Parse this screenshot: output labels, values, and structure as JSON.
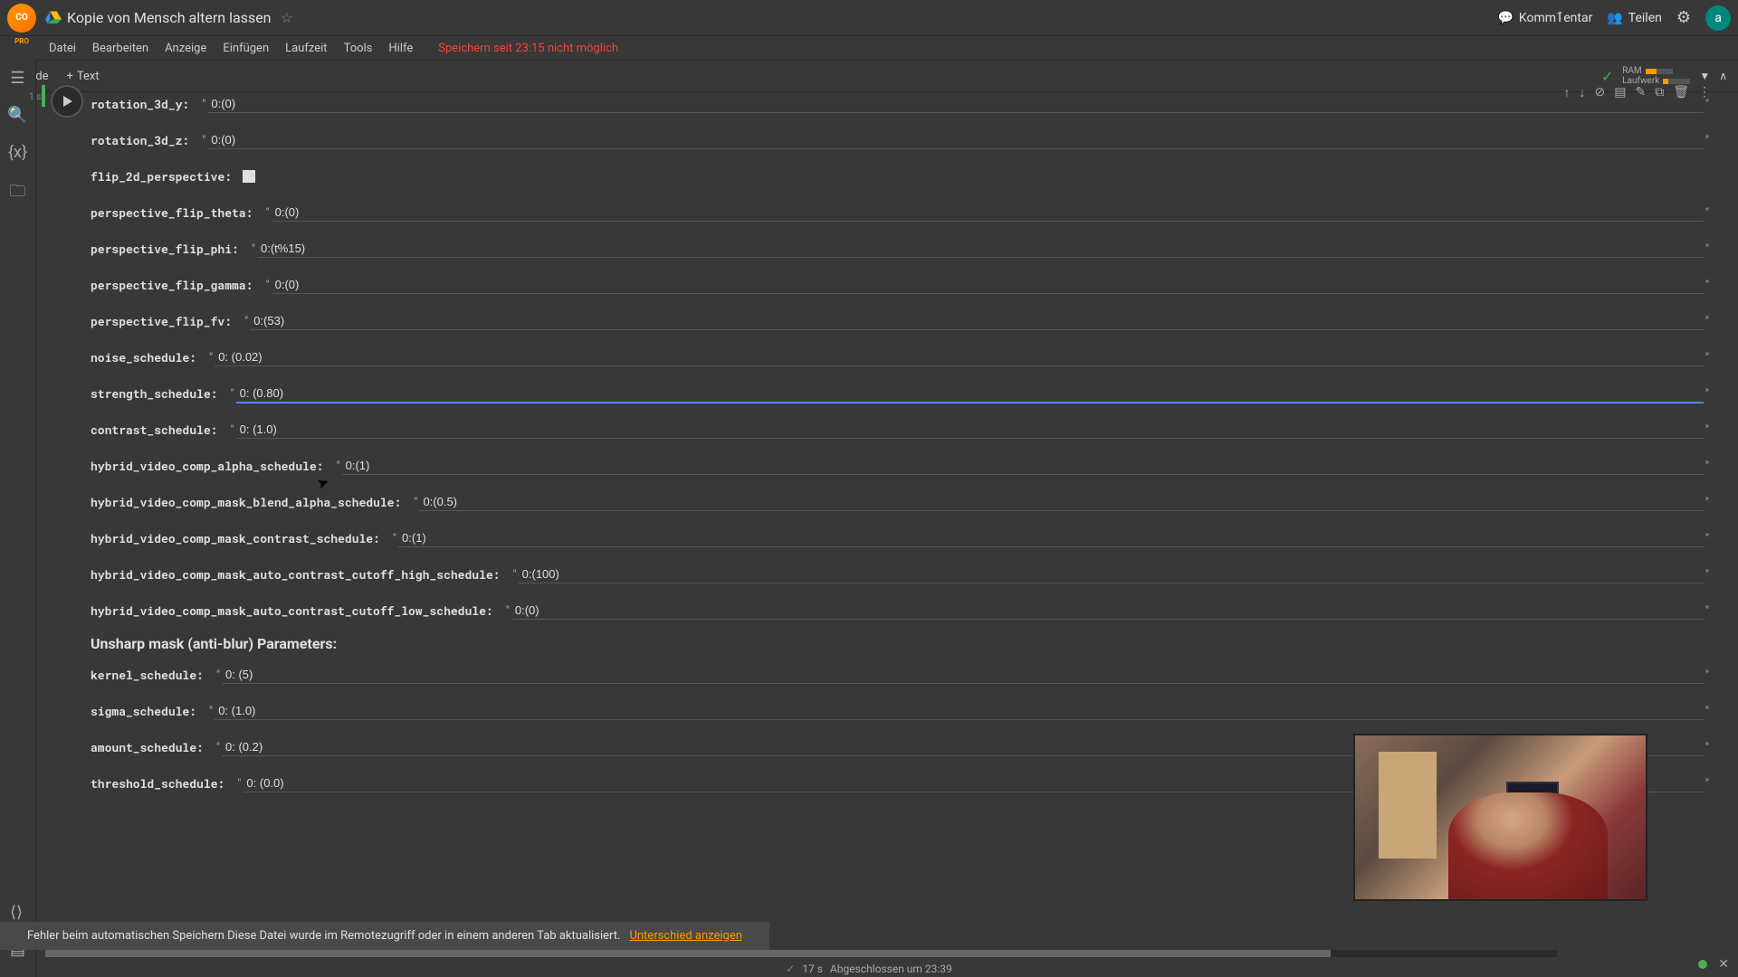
{
  "header": {
    "title": "Kopie von Mensch altern lassen",
    "comment_btn": "Kommٱentar",
    "share_btn": "Teilen",
    "avatar_letter": "a"
  },
  "menubar": {
    "items": [
      "Datei",
      "Bearbeiten",
      "Anzeige",
      "Einfügen",
      "Laufzeit",
      "Tools",
      "Hilfe"
    ],
    "save_error": "Speichern seit 23:15 nicht möglich"
  },
  "toolbar": {
    "code_btn": "Code",
    "text_btn": "Text",
    "ram_label": "RAM",
    "disk_label": "Laufwerk"
  },
  "cell": {
    "time": "1 s"
  },
  "params": [
    {
      "label": "rotation_3d_y:",
      "value": "0:(0)"
    },
    {
      "label": "rotation_3d_z:",
      "value": "0:(0)"
    },
    {
      "label": "flip_2d_perspective:",
      "type": "checkbox"
    },
    {
      "label": "perspective_flip_theta:",
      "value": "0:(0)"
    },
    {
      "label": "perspective_flip_phi:",
      "value": "0:(t%15)"
    },
    {
      "label": "perspective_flip_gamma:",
      "value": "0:(0)"
    },
    {
      "label": "perspective_flip_fv:",
      "value": "0:(53)"
    },
    {
      "label": "noise_schedule:",
      "value": "0: (0.02)"
    },
    {
      "label": "strength_schedule:",
      "value": "0: (0.80)",
      "focused": true
    },
    {
      "label": "contrast_schedule:",
      "value": "0: (1.0)"
    },
    {
      "label": "hybrid_video_comp_alpha_schedule:",
      "value": "0:(1)"
    },
    {
      "label": "hybrid_video_comp_mask_blend_alpha_schedule:",
      "value": "0:(0.5)"
    },
    {
      "label": "hybrid_video_comp_mask_contrast_schedule:",
      "value": "0:(1)"
    },
    {
      "label": "hybrid_video_comp_mask_auto_contrast_cutoff_high_schedule:",
      "value": "0:(100)"
    },
    {
      "label": "hybrid_video_comp_mask_auto_contrast_cutoff_low_schedule:",
      "value": "0:(0)"
    }
  ],
  "section_header": "Unsharp mask (anti-blur) Parameters:",
  "unsharp_params": [
    {
      "label": "kernel_schedule:",
      "value": "0: (5)"
    },
    {
      "label": "sigma_schedule:",
      "value": "0: (1.0)"
    },
    {
      "label": "amount_schedule:",
      "value": "0: (0.2)"
    },
    {
      "label": "threshold_schedule:",
      "value": "0: (0.0)"
    }
  ],
  "error_bar": {
    "text": "Fehler beim automatischen Speichern Diese Datei wurde im Remotezugriff oder in einem anderen Tab aktualisiert.",
    "link": "Unterschied anzeigen"
  },
  "completion": {
    "time": "17 s",
    "text": "Abgeschlossen um 23:39"
  }
}
